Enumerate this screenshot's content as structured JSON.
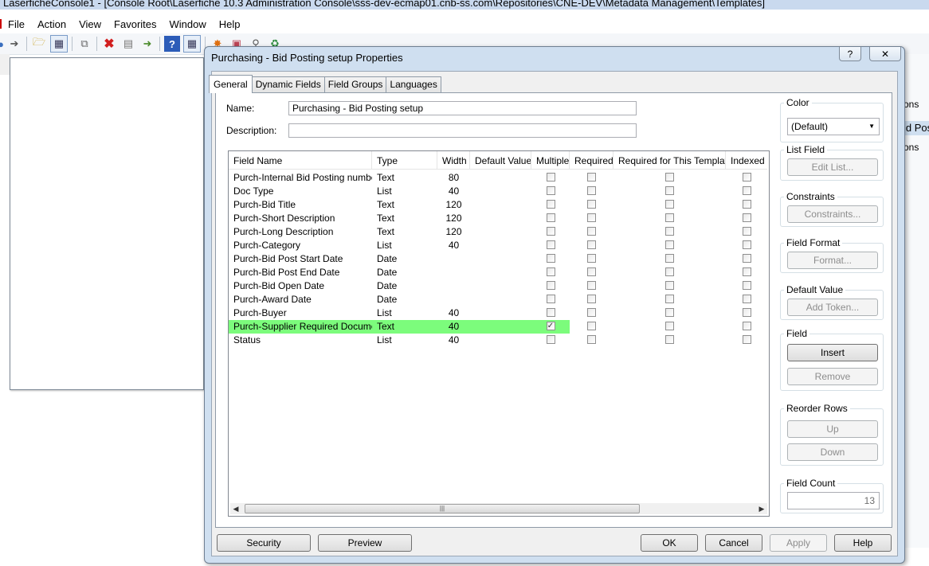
{
  "main_window": {
    "title": "LaserficheConsole1 - [Console Root\\Laserfiche 10.3 Administration Console\\sss-dev-ecmap01.cnb-ss.com\\Repositories\\CNE-DEV\\Metadata Management\\Templates]",
    "menu": [
      "File",
      "Action",
      "View",
      "Favorites",
      "Window",
      "Help"
    ],
    "background_fragments": [
      "ons",
      "id Pos",
      "ons"
    ]
  },
  "dialog": {
    "title": "Purchasing - Bid Posting setup Properties",
    "help_caption": "?",
    "close_caption": "✕",
    "tabs": [
      "General",
      "Dynamic Fields",
      "Field Groups",
      "Languages"
    ],
    "name_label": "Name:",
    "name_value": "Purchasing - Bid Posting setup",
    "description_label": "Description:",
    "description_value": "",
    "grid": {
      "columns": [
        "Field Name",
        "Type",
        "Width",
        "Default Value",
        "Multiple",
        "Required",
        "Required for This Template",
        "Indexed"
      ],
      "rows": [
        {
          "name": "Purch-Internal Bid Posting number",
          "type": "Text",
          "width": "80",
          "multiple": false
        },
        {
          "name": "Doc Type",
          "type": "List",
          "width": "40",
          "multiple": false
        },
        {
          "name": "Purch-Bid Title",
          "type": "Text",
          "width": "120",
          "multiple": false
        },
        {
          "name": "Purch-Short Description",
          "type": "Text",
          "width": "120",
          "multiple": false
        },
        {
          "name": "Purch-Long Description",
          "type": "Text",
          "width": "120",
          "multiple": false
        },
        {
          "name": "Purch-Category",
          "type": "List",
          "width": "40",
          "multiple": false
        },
        {
          "name": "Purch-Bid Post Start Date",
          "type": "Date",
          "width": "",
          "multiple": false
        },
        {
          "name": "Purch-Bid Post End Date",
          "type": "Date",
          "width": "",
          "multiple": false
        },
        {
          "name": "Purch-Bid Open Date",
          "type": "Date",
          "width": "",
          "multiple": false
        },
        {
          "name": "Purch-Award Date",
          "type": "Date",
          "width": "",
          "multiple": false
        },
        {
          "name": "Purch-Buyer",
          "type": "List",
          "width": "40",
          "multiple": false
        },
        {
          "name": "Purch-Supplier Required Documents",
          "type": "Text",
          "width": "40",
          "multiple": true,
          "highlighted": true
        },
        {
          "name": "Status",
          "type": "List",
          "width": "40",
          "multiple": false
        }
      ]
    },
    "side": {
      "color_label": "Color",
      "color_value": "(Default)",
      "list_field_label": "List Field",
      "edit_list_button": "Edit List...",
      "constraints_label": "Constraints",
      "constraints_button": "Constraints...",
      "field_format_label": "Field Format",
      "format_button": "Format...",
      "default_value_label": "Default Value",
      "add_token_button": "Add Token...",
      "field_label": "Field",
      "insert_button": "Insert",
      "remove_button": "Remove",
      "reorder_label": "Reorder Rows",
      "up_button": "Up",
      "down_button": "Down",
      "field_count_label": "Field Count",
      "field_count_value": "13"
    },
    "buttons": {
      "security": "Security",
      "preview": "Preview",
      "ok": "OK",
      "cancel": "Cancel",
      "apply": "Apply",
      "help": "Help"
    },
    "colors": {
      "highlight_row": "#7cfc7c",
      "dialog_frame": "#cfdff0"
    }
  }
}
